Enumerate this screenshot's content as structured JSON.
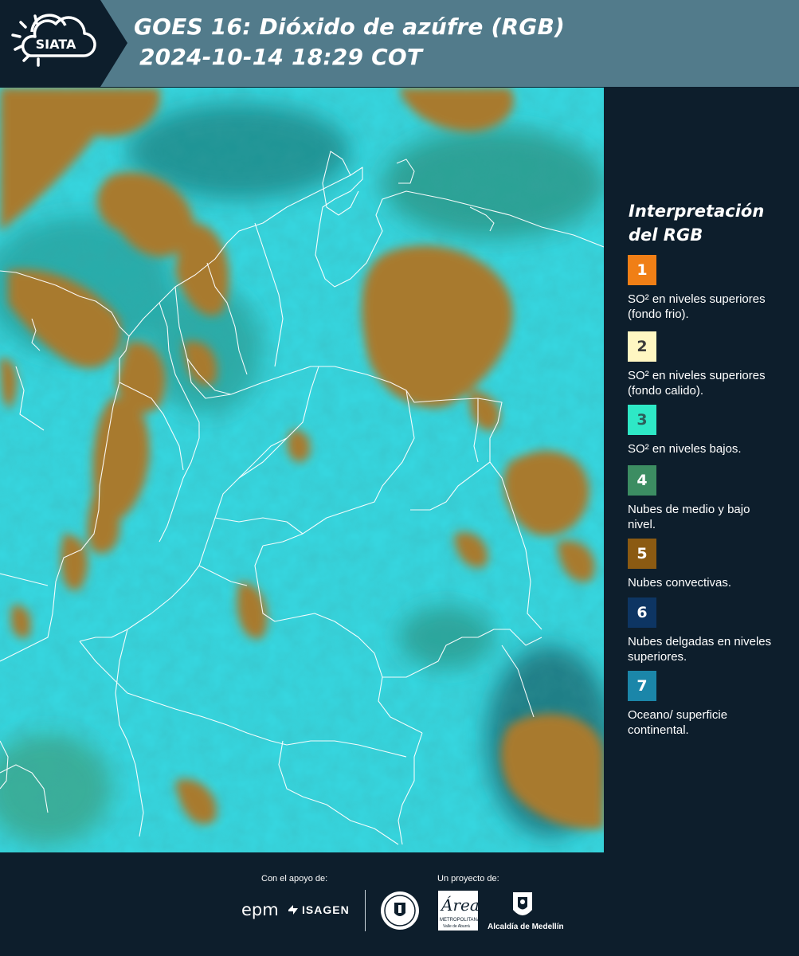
{
  "header": {
    "logo_text": "SIATA",
    "title_line1": "GOES 16: Dióxido de azúfre (RGB)",
    "title_line2": "2024-10-14 18:29 COT"
  },
  "legend": {
    "title_line1": "Interpretación",
    "title_line2": "del RGB",
    "items": [
      {
        "number": "1",
        "color": "#f07f16",
        "number_color": "#ffffff",
        "text": "SO² en niveles superiores (fondo frio)."
      },
      {
        "number": "2",
        "color": "#fff7c2",
        "number_color": "#3a3a3a",
        "text": "SO² en niveles superiores (fondo calido)."
      },
      {
        "number": "3",
        "color": "#2ee8c6",
        "number_color": "#2c5f5a",
        "text": "SO² en niveles bajos."
      },
      {
        "number": "4",
        "color": "#3c8d62",
        "number_color": "#ffffff",
        "text": "Nubes de medio y bajo nivel."
      },
      {
        "number": "5",
        "color": "#8b5a12",
        "number_color": "#ffffff",
        "text": "Nubes convectivas."
      },
      {
        "number": "6",
        "color": "#0d3563",
        "number_color": "#ffffff",
        "text": "Nubes delgadas en niveles superiores."
      },
      {
        "number": "7",
        "color": "#1b86a9",
        "number_color": "#ffffff",
        "text": "Oceano/ superficie continental."
      }
    ]
  },
  "footer": {
    "support_label": "Con el apoyo de:",
    "project_label": "Un proyecto de:",
    "epm": "epm",
    "isagen": "ISAGEN",
    "area_word": "Área",
    "area_line1": "METROPOLITANA",
    "area_line2": "Valle de Aburrá",
    "alcaldia": "Alcaldía de Medellín"
  },
  "colors": {
    "header_bg": "#527b8b",
    "panel_bg": "#0d1e2c",
    "sea_cyan": "#33d4dc",
    "cloud_brown": "#a87a2e"
  }
}
